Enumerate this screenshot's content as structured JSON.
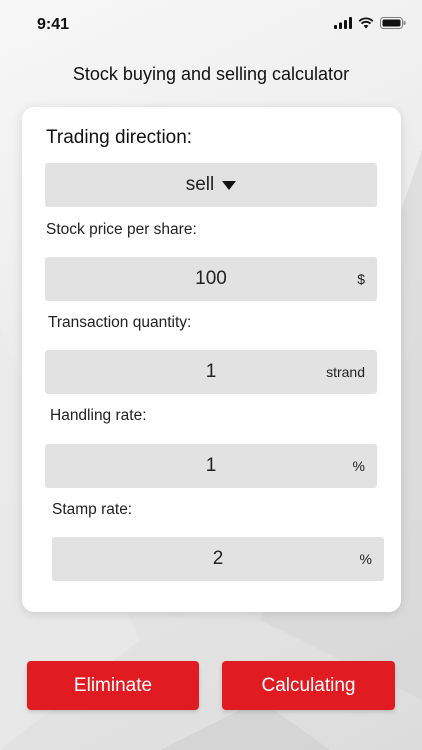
{
  "status_bar": {
    "time": "9:41"
  },
  "header": {
    "title": "Stock buying and selling calculator"
  },
  "form": {
    "direction": {
      "label": "Trading direction:",
      "value": "sell"
    },
    "price": {
      "label": "Stock price per share:",
      "value": "100",
      "unit": "$"
    },
    "quantity": {
      "label": "Transaction quantity:",
      "value": "1",
      "unit": "strand"
    },
    "handling": {
      "label": "Handling rate:",
      "value": "1",
      "unit": "%"
    },
    "stamp": {
      "label": "Stamp rate:",
      "value": "2",
      "unit": "%"
    }
  },
  "actions": {
    "eliminate_label": "Eliminate",
    "calculate_label": "Calculating"
  },
  "colors": {
    "accent": "#e01b22",
    "field_bg": "#e2e2e2"
  },
  "icons": [
    "signal-icon",
    "wifi-icon",
    "battery-icon",
    "caret-down-icon"
  ]
}
